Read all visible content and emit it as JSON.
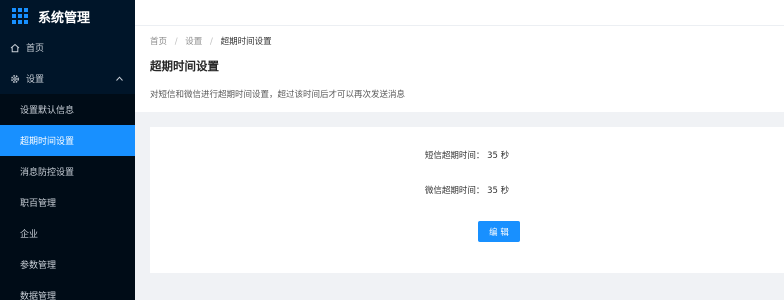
{
  "app": {
    "title": "系统管理"
  },
  "sidebar": {
    "home": {
      "label": "首页",
      "icon": "home-icon"
    },
    "settings": {
      "label": "设置",
      "icon": "gear-icon"
    },
    "items": [
      {
        "label": "设置默认信息"
      },
      {
        "label": "超期时间设置"
      },
      {
        "label": "消息防控设置"
      },
      {
        "label": "职百管理"
      },
      {
        "label": "企业"
      },
      {
        "label": "参数管理"
      },
      {
        "label": "数据管理"
      }
    ]
  },
  "breadcrumb": {
    "home": "首页",
    "sep": "/",
    "settings": "设置",
    "current": "超期时间设置"
  },
  "page": {
    "title": "超期时间设置",
    "desc": "对短信和微信进行超期时间设置，超过该时间后才可以再次发送消息"
  },
  "card": {
    "sms_label": "短信超期时间：",
    "sms_value": "35",
    "sms_unit": "秒",
    "wechat_label": "微信超期时间：",
    "wechat_value": "35",
    "wechat_unit": "秒",
    "edit_label": "编 辑"
  },
  "colors": {
    "sidebar_bg": "#001529",
    "submenu_bg": "#000c17",
    "accent": "#1890ff",
    "page_bg": "#f0f2f5"
  }
}
